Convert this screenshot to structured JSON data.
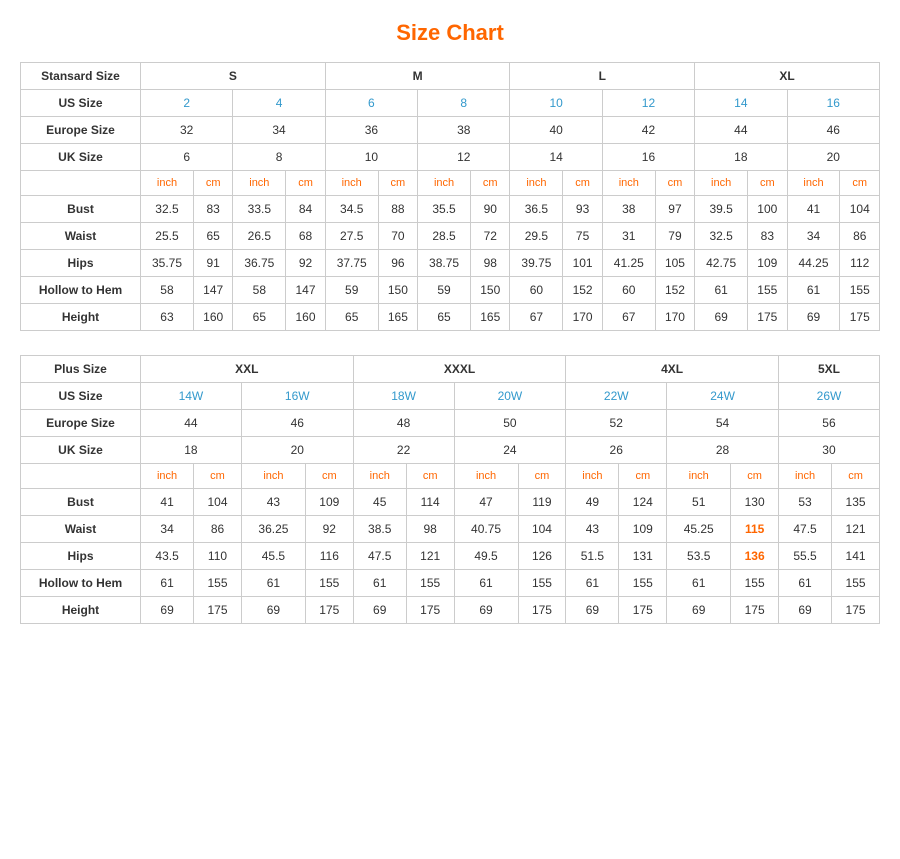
{
  "title": "Size Chart",
  "standard_table": {
    "title": "Standard Size",
    "sections": {
      "size_row": {
        "label": "Stansard Size",
        "cols": [
          {
            "label": "S",
            "span": 4
          },
          {
            "label": "M",
            "span": 4
          },
          {
            "label": "L",
            "span": 4
          },
          {
            "label": "XL",
            "span": 4
          }
        ]
      },
      "us_size": {
        "label": "US Size",
        "vals": [
          "2",
          "4",
          "6",
          "8",
          "10",
          "12",
          "14",
          "16"
        ]
      },
      "europe_size": {
        "label": "Europe Size",
        "vals": [
          "32",
          "34",
          "36",
          "38",
          "40",
          "42",
          "44",
          "46"
        ]
      },
      "uk_size": {
        "label": "UK Size",
        "vals": [
          "6",
          "8",
          "10",
          "12",
          "14",
          "16",
          "18",
          "20"
        ]
      },
      "inch_cm": [
        "inch",
        "cm",
        "inch",
        "cm",
        "inch",
        "cm",
        "inch",
        "cm",
        "inch",
        "cm",
        "inch",
        "cm",
        "inch",
        "cm",
        "inch",
        "cm"
      ],
      "bust": {
        "label": "Bust",
        "vals": [
          "32.5",
          "83",
          "33.5",
          "84",
          "34.5",
          "88",
          "35.5",
          "90",
          "36.5",
          "93",
          "38",
          "97",
          "39.5",
          "100",
          "41",
          "104"
        ]
      },
      "waist": {
        "label": "Waist",
        "vals": [
          "25.5",
          "65",
          "26.5",
          "68",
          "27.5",
          "70",
          "28.5",
          "72",
          "29.5",
          "75",
          "31",
          "79",
          "32.5",
          "83",
          "34",
          "86"
        ]
      },
      "hips": {
        "label": "Hips",
        "vals": [
          "35.75",
          "91",
          "36.75",
          "92",
          "37.75",
          "96",
          "38.75",
          "98",
          "39.75",
          "101",
          "41.25",
          "105",
          "42.75",
          "109",
          "44.25",
          "112"
        ]
      },
      "hollow_to_hem": {
        "label": "Hollow to Hem",
        "vals": [
          "58",
          "147",
          "58",
          "147",
          "59",
          "150",
          "59",
          "150",
          "60",
          "152",
          "60",
          "152",
          "61",
          "155",
          "61",
          "155"
        ]
      },
      "height": {
        "label": "Height",
        "vals": [
          "63",
          "160",
          "65",
          "160",
          "65",
          "165",
          "65",
          "165",
          "67",
          "170",
          "67",
          "170",
          "69",
          "175",
          "69",
          "175"
        ]
      }
    }
  },
  "plus_table": {
    "title": "Plus Size",
    "sections": {
      "size_row": {
        "label": "Plus Size",
        "cols": [
          {
            "label": "XXL",
            "span": 4
          },
          {
            "label": "XXXL",
            "span": 4
          },
          {
            "label": "4XL",
            "span": 4
          },
          {
            "label": "5XL",
            "span": 2
          }
        ]
      },
      "us_size": {
        "label": "US Size",
        "vals": [
          "14W",
          "16W",
          "18W",
          "20W",
          "22W",
          "24W",
          "26W"
        ]
      },
      "europe_size": {
        "label": "Europe Size",
        "vals": [
          "44",
          "46",
          "48",
          "50",
          "52",
          "54",
          "56"
        ]
      },
      "uk_size": {
        "label": "UK Size",
        "vals": [
          "18",
          "20",
          "22",
          "24",
          "26",
          "28",
          "30"
        ]
      },
      "inch_cm": [
        "inch",
        "cm",
        "inch",
        "cm",
        "inch",
        "cm",
        "inch",
        "cm",
        "inch",
        "cm",
        "inch",
        "cm",
        "inch",
        "cm"
      ],
      "bust": {
        "label": "Bust",
        "vals": [
          "41",
          "104",
          "43",
          "109",
          "45",
          "114",
          "47",
          "119",
          "49",
          "124",
          "51",
          "130",
          "53",
          "135"
        ]
      },
      "waist": {
        "label": "Waist",
        "vals": [
          "34",
          "86",
          "36.25",
          "92",
          "38.5",
          "98",
          "40.75",
          "104",
          "43",
          "109",
          "45.25",
          "115",
          "47.5",
          "121"
        ]
      },
      "hips": {
        "label": "Hips",
        "vals": [
          "43.5",
          "110",
          "45.5",
          "116",
          "47.5",
          "121",
          "49.5",
          "126",
          "51.5",
          "131",
          "53.5",
          "136",
          "55.5",
          "141"
        ]
      },
      "hollow_to_hem": {
        "label": "Hollow to Hem",
        "vals": [
          "61",
          "155",
          "61",
          "155",
          "61",
          "155",
          "61",
          "155",
          "61",
          "155",
          "61",
          "155",
          "61",
          "155"
        ]
      },
      "height": {
        "label": "Height",
        "vals": [
          "69",
          "175",
          "69",
          "175",
          "69",
          "175",
          "69",
          "175",
          "69",
          "175",
          "69",
          "175",
          "69",
          "175"
        ]
      }
    }
  }
}
